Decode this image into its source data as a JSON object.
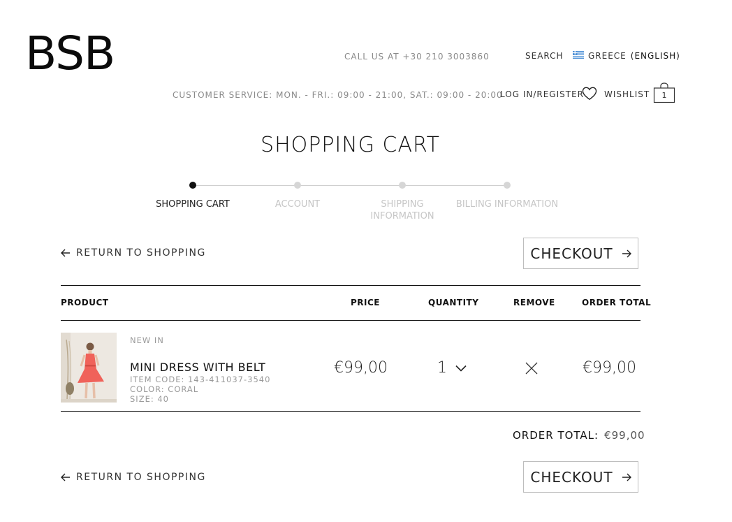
{
  "brand": {
    "logo_text": "BSB"
  },
  "header": {
    "call_us": "CALL US AT +30 210 3003860",
    "customer_service": "CUSTOMER SERVICE: MON. - FRI.: 09:00 - 21:00, SAT.: 09:00 - 20:00",
    "search_label": "SEARCH",
    "country_label": "GREECE",
    "language_label": "(ENGLISH)",
    "login_label": "LOG IN/REGISTER",
    "wishlist_label": "WISHLIST",
    "cart_count": "1"
  },
  "page": {
    "title": "SHOPPING CART"
  },
  "steps": [
    {
      "label": "SHOPPING CART",
      "active": true
    },
    {
      "label": "ACCOUNT",
      "active": false
    },
    {
      "label": "SHIPPING INFORMATION",
      "active": false
    },
    {
      "label": "BILLING INFORMATION",
      "active": false
    }
  ],
  "actions": {
    "return_label": "RETURN TO SHOPPING",
    "checkout_label": "CHECKOUT"
  },
  "table": {
    "headers": {
      "product": "PRODUCT",
      "price": "PRICE",
      "quantity": "QUANTITY",
      "remove": "REMOVE",
      "order_total": "ORDER TOTAL"
    },
    "items": [
      {
        "badge": "NEW IN",
        "name": "MINI DRESS WITH BELT",
        "item_code": "ITEM CODE: 143-411037-3540",
        "color": "COLOR: CORAL",
        "size": "SIZE: 40",
        "price": "€99,00",
        "quantity": "1",
        "total": "€99,00"
      }
    ]
  },
  "summary": {
    "label": "ORDER TOTAL:",
    "value": "€99,00"
  },
  "colors": {
    "accent_dark": "#111111",
    "inactive_step": "#d6d6d6",
    "product_coral": "#f0625a"
  }
}
